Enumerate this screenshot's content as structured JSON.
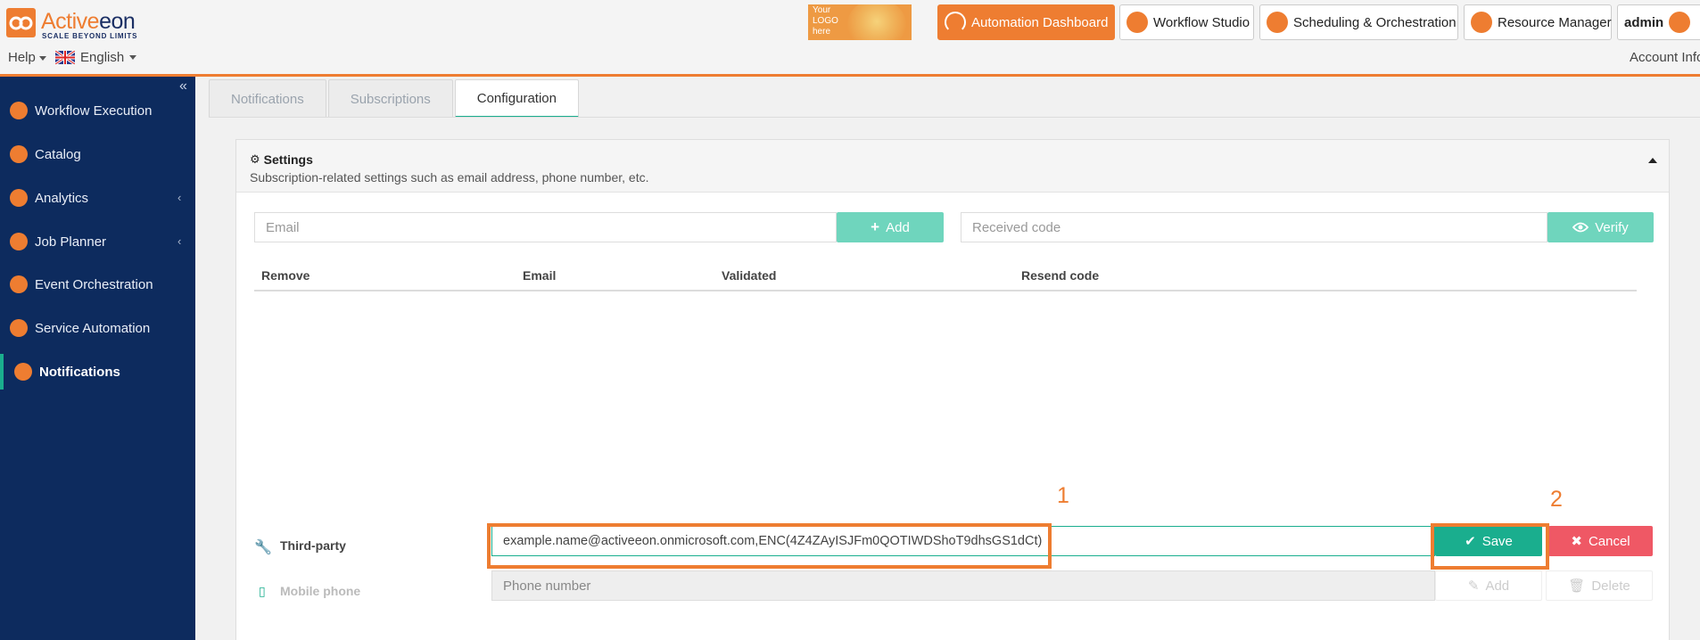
{
  "brand": {
    "name_part1": "Active",
    "name_part2": "eon",
    "tagline": "SCALE BEYOND LIMITS",
    "logo_placeholder": "Your\nLOGO\nhere",
    "accent_color": "#ee7d31",
    "navy_color": "#0d2b5e",
    "teal_color": "#1aae8e"
  },
  "header": {
    "help_label": "Help",
    "language_label": "English",
    "account_label": "Account Info",
    "buttons": {
      "automation_dashboard": "Automation Dashboard",
      "workflow_studio": "Workflow Studio",
      "scheduling": "Scheduling & Orchestration",
      "resource_manager": "Resource Manager",
      "admin": "admin"
    }
  },
  "sidebar": {
    "items": [
      {
        "label": "Workflow Execution",
        "icon": "speedometer-icon"
      },
      {
        "label": "Catalog",
        "icon": "catalog-icon"
      },
      {
        "label": "Analytics",
        "icon": "analytics-icon",
        "has_submenu": true
      },
      {
        "label": "Job Planner",
        "icon": "clock-icon",
        "has_submenu": true
      },
      {
        "label": "Event Orchestration",
        "icon": "event-icon"
      },
      {
        "label": "Service Automation",
        "icon": "paas-icon"
      },
      {
        "label": "Notifications",
        "icon": "notification-icon",
        "active": true
      }
    ]
  },
  "tabs": [
    {
      "label": "Notifications"
    },
    {
      "label": "Subscriptions"
    },
    {
      "label": "Configuration",
      "active": true
    }
  ],
  "settings": {
    "title": "Settings",
    "subtitle": "Subscription-related settings such as email address, phone number, etc.",
    "email_placeholder": "Email",
    "add_label": "Add",
    "code_placeholder": "Received code",
    "verify_label": "Verify",
    "table_columns": [
      "Remove",
      "Email",
      "Validated",
      "Resend code"
    ],
    "third_party_label": "Third-party",
    "third_party_value": "example.name@activeeon.onmicrosoft.com,ENC(4Z4ZAyISJFm0QOTIWDShoT9dhsGS1dCt)",
    "save_label": "Save",
    "cancel_label": "Cancel",
    "mobile_label": "Mobile phone",
    "phone_placeholder": "Phone number",
    "phone_add_label": "Add",
    "phone_delete_label": "Delete"
  },
  "annotations": {
    "step1": "1",
    "step2": "2"
  }
}
